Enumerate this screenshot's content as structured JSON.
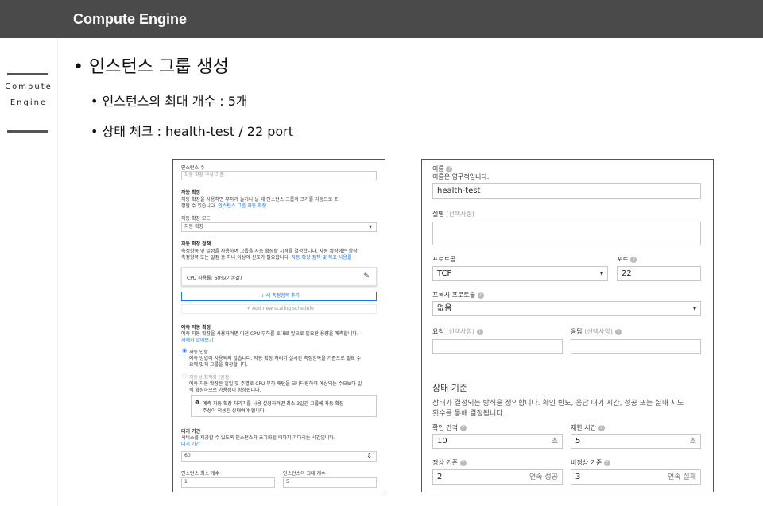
{
  "header": {
    "title": "Compute Engine"
  },
  "sidebar": {
    "line1": "Compute",
    "line2": "Engine"
  },
  "bullets": {
    "main": "인스턴스 그룹 생성",
    "sub1": "인스턴스의 최대 개수 : 5개",
    "sub2": "상태 체크 : health-test / 22 port"
  },
  "left_panel": {
    "instances_label": "인스턴스 수",
    "instances_placeholder": "자동 확장 구성 기준",
    "autoscale_title": "자동 확장",
    "autoscale_desc1": "자동 확장을 사용하면 부하가 늘거나 날 때 인스턴스 그룹의 크기를 자동으로 조",
    "autoscale_desc2": "정할 수 있습니다.",
    "autoscale_link": "인스턴스 그룹 자동 확장",
    "mode_label": "자동 확장 모드",
    "mode_value": "자동 확장",
    "policy_title": "자동 확장 정책",
    "policy_desc1": "측정항목 및 일정을 사용하여 그룹을 자동 확장할 시점을 결정합니다. 자동 확장에는 항상",
    "policy_desc2": "측정항목 또는 일정 중 하나 이상의 신호가 필요합니다.",
    "policy_link": "자동 확장 정책 및 목표 사용률",
    "cpu_policy": "CPU 사용률: 60%(기본값)",
    "add_metric": "+ 새 측정항목 추가",
    "add_schedule": "+ Add new scaling schedule",
    "predict_title": "예측 자동 확장",
    "predict_desc": "예측 자동 확장을 사용하려면 이전 CPU 부하를 토대로 앞으로 필요한 용량을 예측합니다.",
    "predict_link": "자세히 알아보기",
    "radio1_label": "자동 안함",
    "radio1_desc1": "예측 방법이 사용되지 않습니다. 자동 확장 처리기 실시간 측정항목을 기준으로 필요 수",
    "radio1_desc2": "요에 맞게 그룹을 확장합니다.",
    "radio2_label": "자동성 최적화 (권장)",
    "radio2_desc1": "예측 자동 확장은 일일 및 주별로 CPU 부하 패턴을 모니터링하여 예상되는 수요보다 일",
    "radio2_desc2": "찍 확장하므로 가용성이 향상됩니다.",
    "info_text1": "예측 자동 확장 처리기를 사용 설정하려면 최소 3일간 그룹에 자동 확장",
    "info_text2": "주성이 적용된 상태여야 합니다.",
    "cooldown_label": "대기 기간",
    "cooldown_desc": "서비스를 제공할 수 있도록 인스턴스가 초기화될 때까지 기다리는 시간입니다.",
    "cooldown_link": "대기 기간",
    "cooldown_value": "60",
    "min_label": "인스턴스 최소 개수",
    "min_value": "1",
    "max_label": "인스턴스의 최대 개수",
    "max_value": "5"
  },
  "right_panel": {
    "name_label": "이름",
    "name_note": "이름은 영구적입니다.",
    "name_value": "health-test",
    "desc_label": "설명",
    "optional": "(선택사항)",
    "protocol_label": "프로토콜",
    "protocol_value": "TCP",
    "port_label": "포트",
    "port_value": "22",
    "proxy_label": "프록시 프로토콜",
    "proxy_value": "없음",
    "request_label": "요청",
    "response_label": "응답",
    "criteria_title": "상태 기준",
    "criteria_desc1": "상태가 결정되는 방식을 정의합니다. 확인 빈도, 응답 대기 시간, 성공 또는 실패 시도",
    "criteria_desc2": "횟수를 통해 결정됩니다.",
    "interval_label": "확인 간격",
    "interval_value": "10",
    "timeout_label": "제한 시간",
    "timeout_value": "5",
    "seconds_unit": "초",
    "healthy_label": "정상 기준",
    "healthy_value": "2",
    "healthy_suffix": "연속 성공",
    "unhealthy_label": "비정상 기준",
    "unhealthy_value": "3",
    "unhealthy_suffix": "연속 실패"
  },
  "colors": {
    "header_bg": "#4a4a4a",
    "link": "#1a73e8"
  }
}
